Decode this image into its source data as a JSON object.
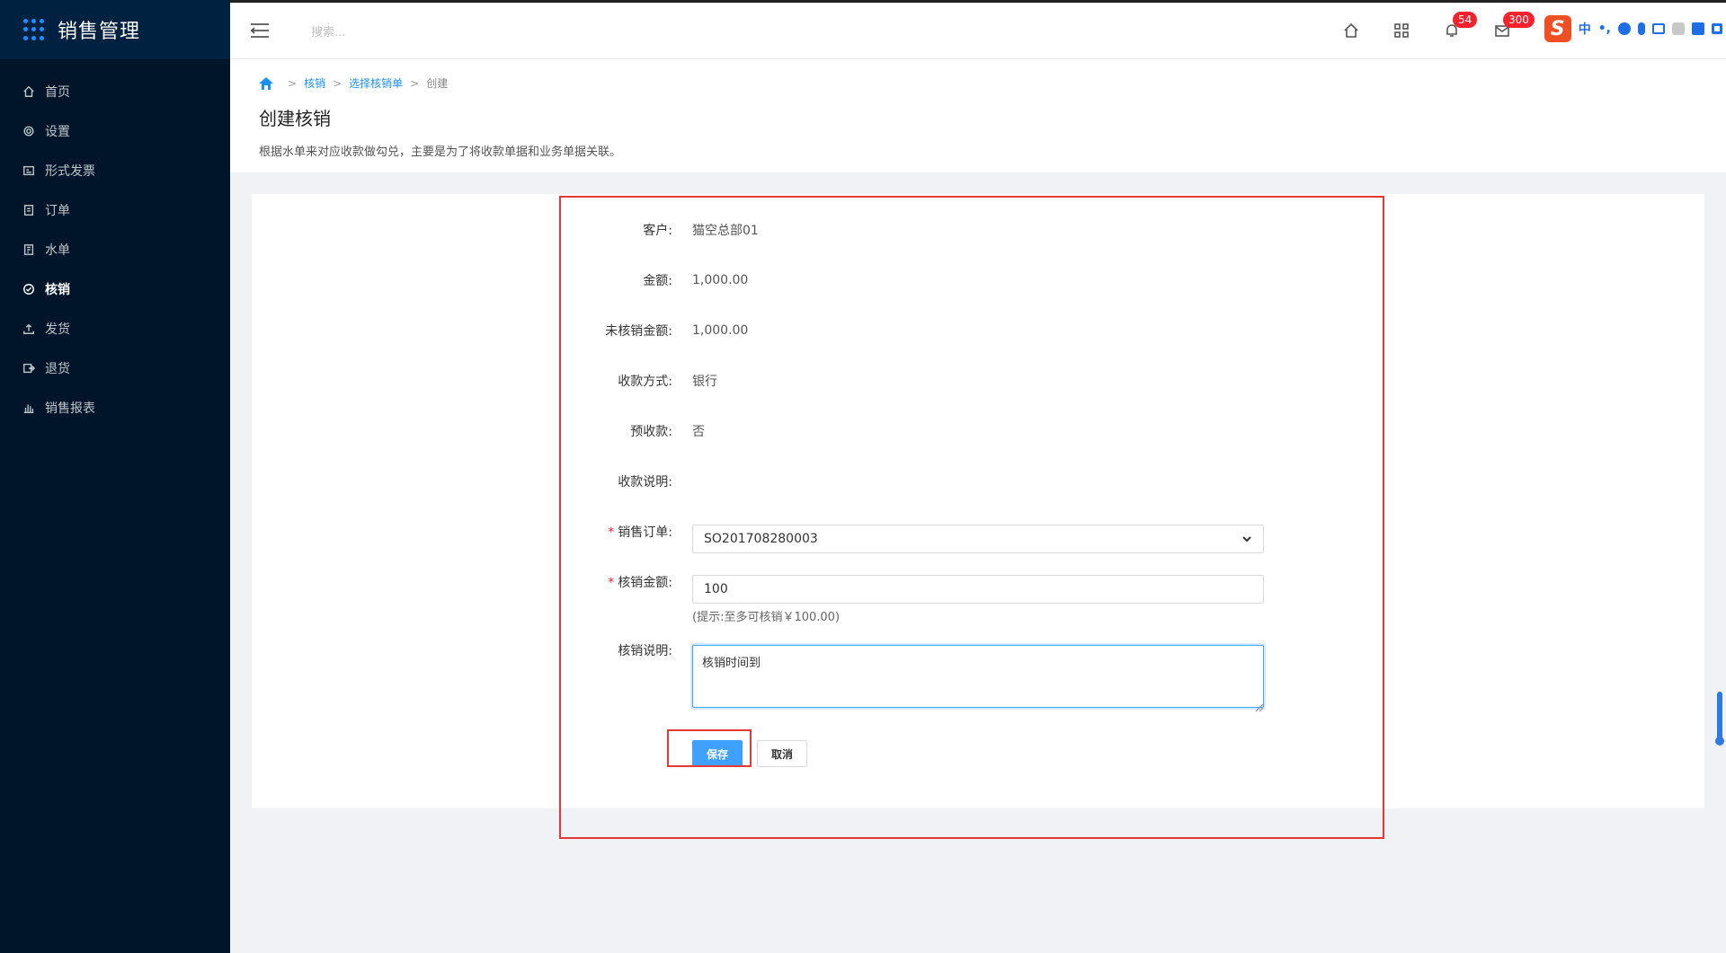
{
  "app": {
    "title": "销售管理"
  },
  "sidebar": {
    "items": [
      {
        "label": "首页",
        "icon": "home-icon",
        "active": false
      },
      {
        "label": "设置",
        "icon": "gear-icon",
        "active": false
      },
      {
        "label": "形式发票",
        "icon": "invoice-icon",
        "active": false
      },
      {
        "label": "订单",
        "icon": "order-icon",
        "active": false
      },
      {
        "label": "水单",
        "icon": "receipt-icon",
        "active": false
      },
      {
        "label": "核销",
        "icon": "check-circle-icon",
        "active": true
      },
      {
        "label": "发货",
        "icon": "upload-icon",
        "active": false
      },
      {
        "label": "退货",
        "icon": "return-icon",
        "active": false
      },
      {
        "label": "销售报表",
        "icon": "bar-chart-icon",
        "active": false
      }
    ]
  },
  "header": {
    "search_placeholder": "搜索...",
    "notifications_count": "54",
    "messages_count": "300",
    "ime": {
      "lang": "中",
      "punct": "•,"
    }
  },
  "breadcrumb": {
    "items": [
      "核销",
      "选择核销单",
      "创建"
    ]
  },
  "page": {
    "title": "创建核销",
    "description": "根据水单来对应收款做勾兑，主要是为了将收款单据和业务单据关联。"
  },
  "form": {
    "customer": {
      "label": "客户:",
      "value": "猫空总部01"
    },
    "amount": {
      "label": "金额:",
      "value": "1,000.00"
    },
    "unwritten_amount": {
      "label": "未核销金额:",
      "value": "1,000.00"
    },
    "payment_method": {
      "label": "收款方式:",
      "value": "银行"
    },
    "prepayment": {
      "label": "预收款:",
      "value": "否"
    },
    "payment_note": {
      "label": "收款说明:",
      "value": ""
    },
    "sales_order": {
      "label": "销售订单:",
      "value": "SO201708280003",
      "required": true
    },
    "writeoff_amount": {
      "label": "核销金额:",
      "value": "100",
      "hint": "(提示:至多可核销￥100.00)",
      "required": true
    },
    "writeoff_note": {
      "label": "核销说明:",
      "value": "核销时间到"
    },
    "save_label": "保存",
    "cancel_label": "取消"
  },
  "colors": {
    "sidebar_bg": "#001529",
    "primary": "#40a0ff",
    "highlight_frame": "#e53935",
    "badge": "#f5222d"
  }
}
